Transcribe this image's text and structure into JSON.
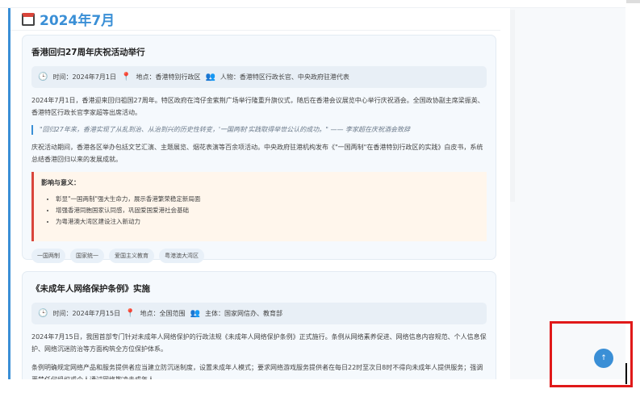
{
  "month": {
    "title": "2024年7月",
    "icon": "calendar-icon"
  },
  "events": [
    {
      "title": "香港回归27周年庆祝活动举行",
      "meta": {
        "time": "时间：2024年7月1日",
        "place": "地点：香港特别行政区",
        "people": "人物：香港特区行政长官、中央政府驻港代表"
      },
      "p1": "2024年7月1日，香港迎来回归祖国27周年。特区政府在湾仔金紫荆广场举行隆重升旗仪式，随后在香港会议展览中心举行庆祝酒会。全国政协副主席梁振英、香港特区行政长官李家超等出席活动。",
      "quote": "\"回归27年来，香港实现了从乱到治、从治到兴的历史性转变，'一国两制'实践取得举世公认的成功。\" —— 李家超在庆祝酒会致辞",
      "p2": "庆祝活动期间，香港各区举办包括文艺汇演、主题展览、烟花表演等百余项活动。中央政府驻港机构发布《\"一国两制\"在香港特别行政区的实践》白皮书，系统总结香港回归以来的发展成就。",
      "impact_title": "影响与意义：",
      "impact": [
        "彰显\"一国两制\"强大生命力，展示香港繁荣稳定新局面",
        "增强香港同胞国家认同感，巩固爱国爱港社会基础",
        "为粤港澳大湾区建设注入新动力"
      ],
      "tags": [
        "一国两制",
        "国家统一",
        "爱国主义教育",
        "粤港澳大湾区"
      ]
    },
    {
      "title": "《未成年人网络保护条例》实施",
      "meta": {
        "time": "时间：2024年7月15日",
        "place": "地点：全国范围",
        "people": "主体：国家网信办、教育部"
      },
      "p1": "2024年7月15日，我国首部专门针对未成年人网络保护的行政法规《未成年人网络保护条例》正式施行。条例从网络素养促进、网络信息内容规范、个人信息保护、网络沉迷防治等方面构筑全方位保护体系。",
      "p2": "条例明确规定网络产品和服务提供者应当建立防沉迷制度，设置未成年人模式；要求网络游戏服务提供者在每日22时至次日8时不得向未成年人提供服务；强调严禁任何组织或个人通过网络欺凌未成年人。"
    }
  ],
  "back_to_top": "↑",
  "colors": {
    "accent": "#3a8fd6",
    "impact": "#d9453b",
    "highlight": "#e01919"
  }
}
